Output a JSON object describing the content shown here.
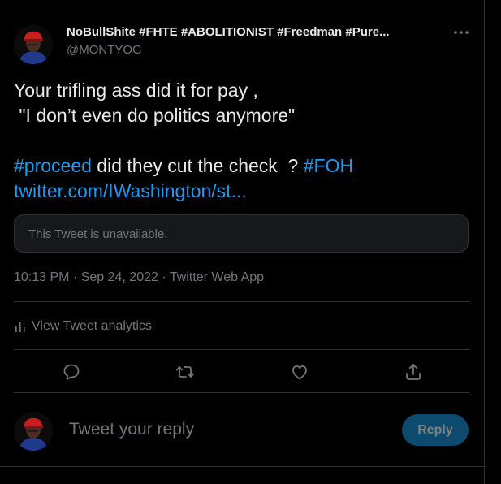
{
  "author": {
    "name": "NoBullShite #FHTE #ABOLITIONIST #Freedman #Pure...",
    "handle": "@MONTYOG"
  },
  "tweet": {
    "line1": "Your trifling ass did it for pay ,",
    "line2": " \"I don’t even do politics anymore\"",
    "hashtag_proceed": "#proceed",
    "middle_text": " did they cut the check  ? ",
    "hashtag_foh": "#FOH",
    "link": "twitter.com/IWashington/st..."
  },
  "quoted": {
    "unavailable_text": "This Tweet is unavailable."
  },
  "meta": {
    "timestamp": "10:13 PM · Sep 24, 2022 · Twitter Web App"
  },
  "analytics": {
    "label": "View Tweet analytics",
    "icon": "analytics-bars-icon"
  },
  "actions": {
    "icons": [
      "reply-icon",
      "retweet-icon",
      "like-icon",
      "share-icon"
    ]
  },
  "compose": {
    "placeholder": "Tweet your reply",
    "button_label": "Reply"
  },
  "colors": {
    "background": "#000000",
    "text_primary": "#e7e9ea",
    "text_secondary": "#71767b",
    "accent": "#1d9bf0",
    "border": "#2f3336",
    "reply_button_disabled": "#0c4a6e"
  }
}
